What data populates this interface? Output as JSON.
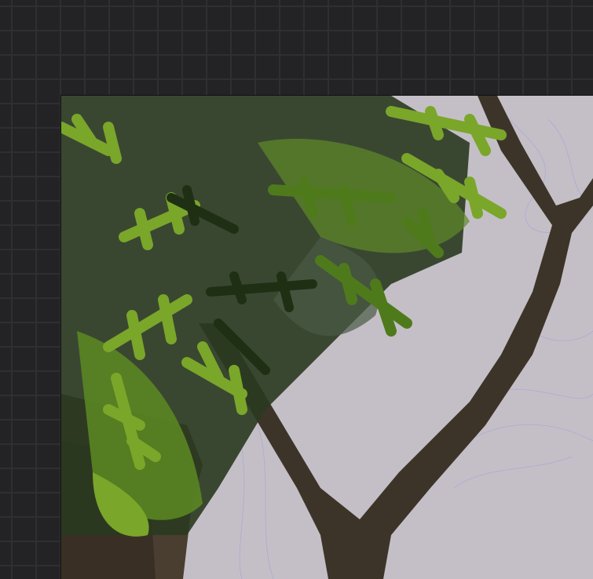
{
  "colors": {
    "workspace": "#232325",
    "grid": "#2f2f31",
    "paper": "#c4bfc6",
    "trunk": "#3d3429",
    "leaf_light": "#7aa62a",
    "leaf_mid": "#4f7a1c",
    "leaf_dark": "#1e2f14",
    "sketch": "#a9a6d6"
  }
}
